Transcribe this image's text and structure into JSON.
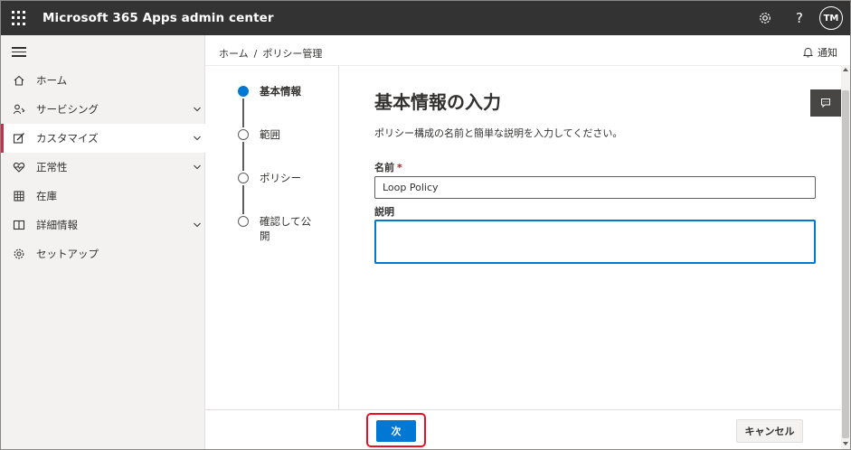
{
  "app": {
    "title": "Microsoft 365 Apps admin center",
    "help": "?",
    "avatar_initials": "TM"
  },
  "sidebar": {
    "items": [
      {
        "label": "ホーム",
        "icon": "home-icon",
        "expandable": false
      },
      {
        "label": "サービシング",
        "icon": "servicing-icon",
        "expandable": true
      },
      {
        "label": "カスタマイズ",
        "icon": "customize-icon",
        "expandable": true,
        "selected": true
      },
      {
        "label": "正常性",
        "icon": "health-icon",
        "expandable": true
      },
      {
        "label": "在庫",
        "icon": "inventory-icon",
        "expandable": false
      },
      {
        "label": "詳細情報",
        "icon": "book-icon",
        "expandable": true
      },
      {
        "label": "セットアップ",
        "icon": "gear-icon",
        "expandable": false
      }
    ]
  },
  "breadcrumb": {
    "home": "ホーム",
    "separator": "/",
    "current": "ポリシー管理"
  },
  "notify": {
    "label": "通知"
  },
  "stepper": {
    "steps": [
      {
        "label": "基本情報",
        "active": true
      },
      {
        "label": "範囲",
        "active": false
      },
      {
        "label": "ポリシー",
        "active": false
      },
      {
        "label_line1": "確認して公",
        "label_line2": "開",
        "active": false
      }
    ]
  },
  "form": {
    "title": "基本情報の入力",
    "description": "ポリシー構成の名前と簡単な説明を入力してください。",
    "name_label": "名前",
    "required_marker": "*",
    "name_value": "Loop Policy",
    "description_label": "説明",
    "description_value": ""
  },
  "footer": {
    "next_label": "次",
    "cancel_label": "キャンセル"
  },
  "colors": {
    "accent": "#0078d4",
    "topbar": "#333333",
    "selected_marker": "#c4314b",
    "highlight": "#e81123"
  }
}
